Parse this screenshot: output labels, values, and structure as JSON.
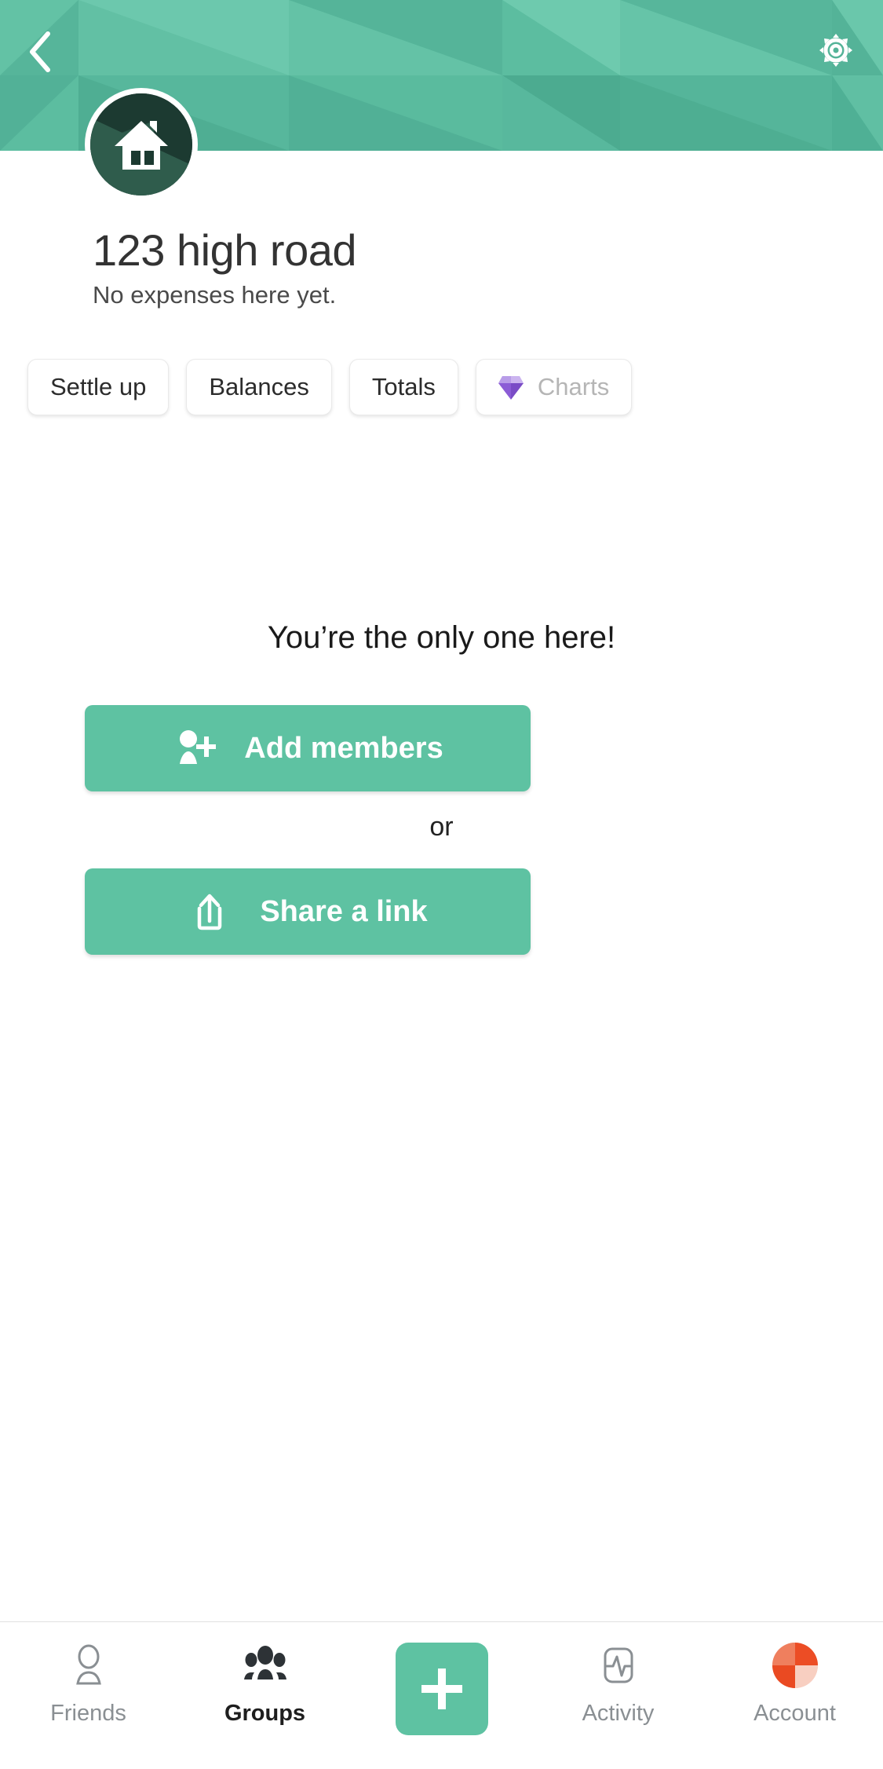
{
  "header": {
    "back_icon": "chevron-left-icon",
    "settings_icon": "gear-icon",
    "background_color": "#5cbda0"
  },
  "group": {
    "avatar_icon": "house-icon",
    "name": "123 high road",
    "subtitle": "No expenses here yet."
  },
  "chips": [
    {
      "label": "Settle up",
      "icon": null
    },
    {
      "label": "Balances",
      "icon": null
    },
    {
      "label": "Totals",
      "icon": null
    },
    {
      "label": "Charts",
      "icon": "gem-icon"
    }
  ],
  "empty_state": {
    "heading": "You’re the only one here!",
    "add_members_label": "Add members",
    "add_members_icon": "person-add-icon",
    "or_label": "or",
    "share_link_label": "Share a link",
    "share_link_icon": "share-upload-icon"
  },
  "bottom_nav": {
    "items": [
      {
        "label": "Friends",
        "icon": "person-outline-icon",
        "active": false
      },
      {
        "label": "Groups",
        "icon": "people-filled-icon",
        "active": true
      },
      {
        "label": "",
        "icon": "plus-icon",
        "active": false
      },
      {
        "label": "Activity",
        "icon": "activity-pulse-icon",
        "active": false
      },
      {
        "label": "Account",
        "icon": "account-avatar-icon",
        "active": false
      }
    ]
  },
  "colors": {
    "accent": "#5ec2a2",
    "header_teal": "#5cbda0",
    "avatar_dark_green": "#1c3a31",
    "gem_purple": "#8b5cd6",
    "account_orange": "#ea4a22"
  }
}
